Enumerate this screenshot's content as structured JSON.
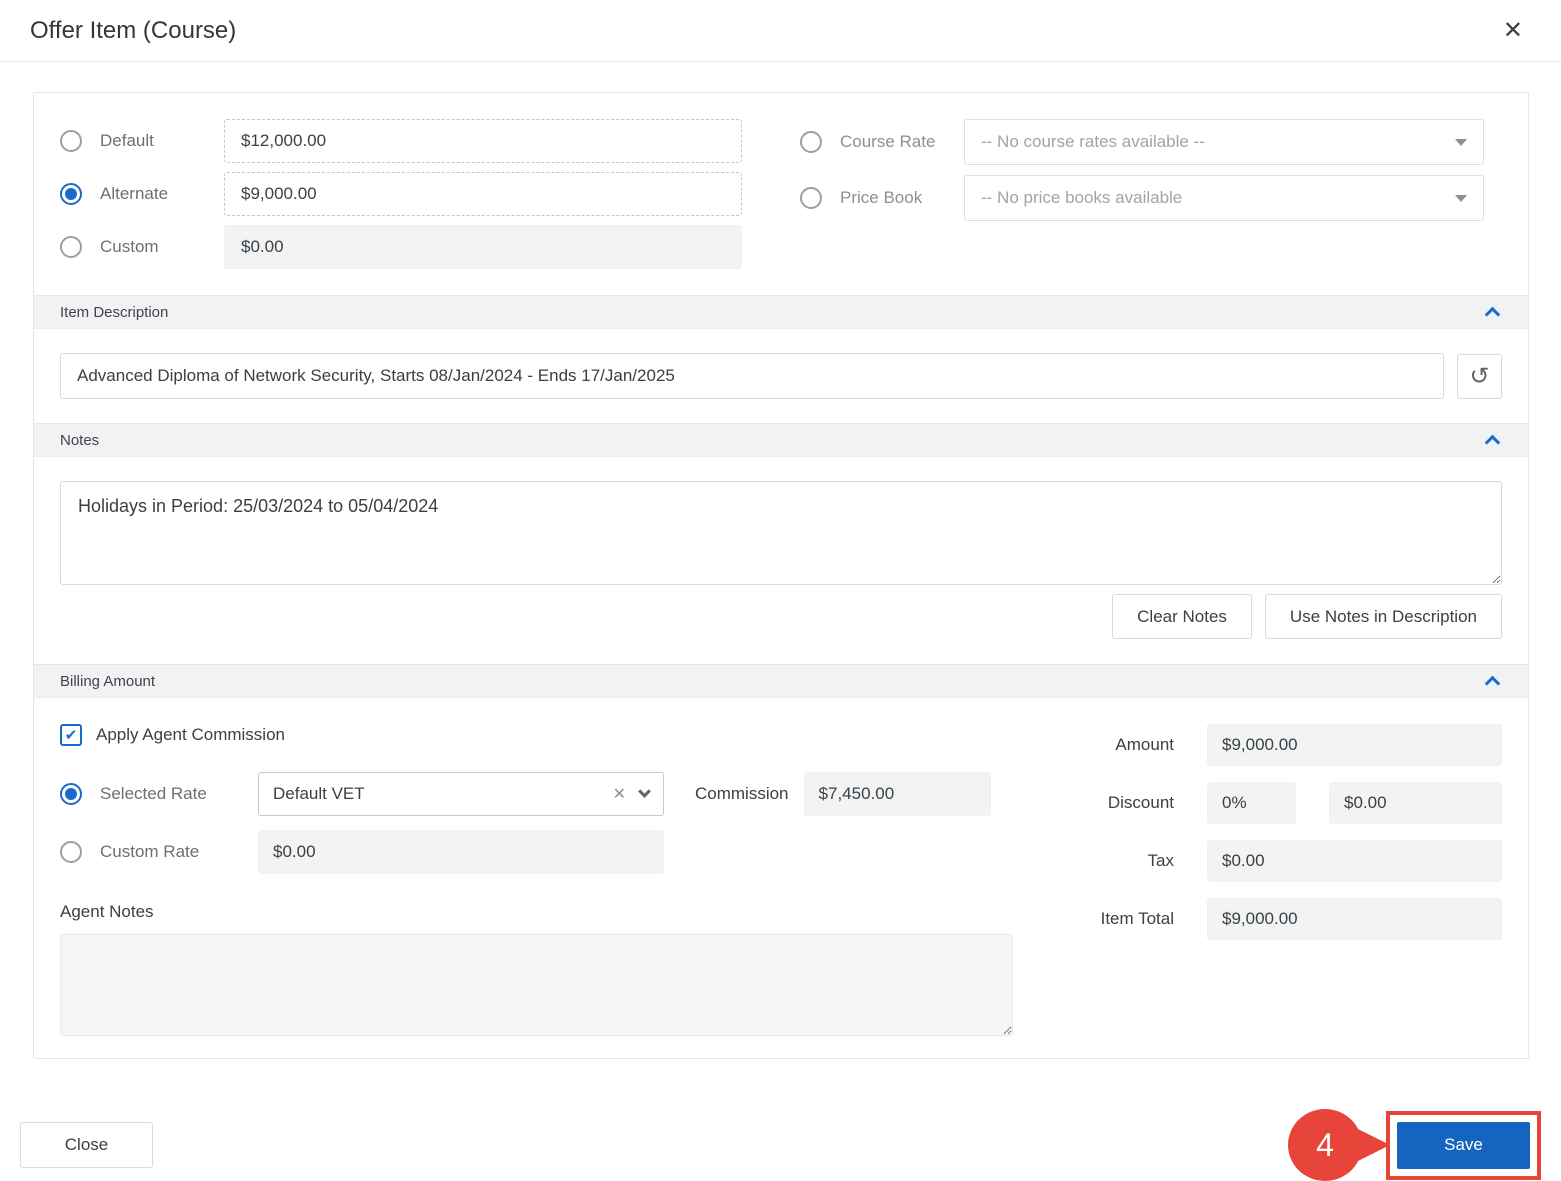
{
  "modal": {
    "title": "Offer Item (Course)"
  },
  "icons": {
    "close": "✕",
    "history": "↺",
    "check": "✔",
    "clear": "✕"
  },
  "pricing": {
    "options": [
      {
        "label": "Default",
        "value": "$12,000.00"
      },
      {
        "label": "Alternate",
        "value": "$9,000.00"
      },
      {
        "label": "Custom",
        "value": "$0.00"
      }
    ],
    "course_rate_label": "Course Rate",
    "course_rate_placeholder": "-- No course rates available --",
    "price_book_label": "Price Book",
    "price_book_placeholder": "-- No price books available"
  },
  "item_description": {
    "title": "Item Description",
    "value": "Advanced Diploma of Network Security, Starts 08/Jan/2024 - Ends 17/Jan/2025"
  },
  "notes": {
    "title": "Notes",
    "value": "Holidays in Period: 25/03/2024 to 05/04/2024",
    "clear_button": "Clear Notes",
    "use_in_description_button": "Use Notes in Description"
  },
  "billing": {
    "title": "Billing Amount",
    "apply_agent_commission_label": "Apply Agent Commission",
    "selected_rate_label": "Selected Rate",
    "selected_rate_value": "Default VET",
    "commission_label": "Commission",
    "commission_value": "$7,450.00",
    "custom_rate_label": "Custom Rate",
    "custom_rate_value": "$0.00",
    "agent_notes_label": "Agent Notes",
    "agent_notes_value": "",
    "summary": {
      "amount_label": "Amount",
      "amount_value": "$9,000.00",
      "discount_label": "Discount",
      "discount_percent": "0%",
      "discount_value": "$0.00",
      "tax_label": "Tax",
      "tax_value": "$0.00",
      "item_total_label": "Item Total",
      "item_total_value": "$9,000.00"
    }
  },
  "footer": {
    "close_button": "Close",
    "save_button": "Save"
  },
  "annotation": {
    "step_number": "4"
  },
  "colors": {
    "accent_blue": "#1b6ac9",
    "save_blue": "#1565c0",
    "annotation_red": "#e8453a"
  }
}
